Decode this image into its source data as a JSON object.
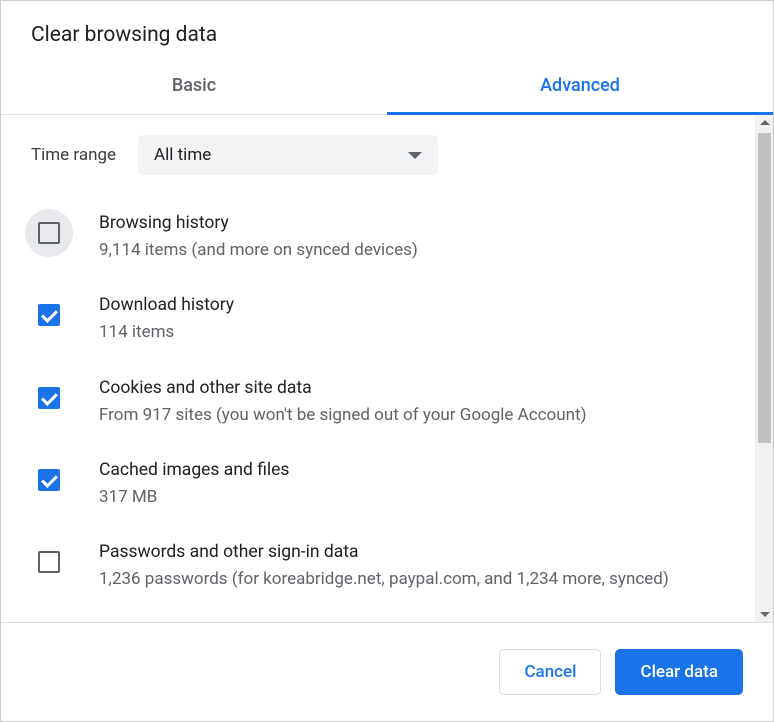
{
  "dialog": {
    "title": "Clear browsing data",
    "tabs": {
      "basic": "Basic",
      "advanced": "Advanced"
    },
    "time_range_label": "Time range",
    "time_range_value": "All time",
    "items": [
      {
        "title": "Browsing history",
        "subtitle": "9,114 items (and more on synced devices)",
        "checked": false,
        "hover": true
      },
      {
        "title": "Download history",
        "subtitle": "114 items",
        "checked": true
      },
      {
        "title": "Cookies and other site data",
        "subtitle": "From 917 sites (you won't be signed out of your Google Account)",
        "checked": true
      },
      {
        "title": "Cached images and files",
        "subtitle": "317 MB",
        "checked": true
      },
      {
        "title": "Passwords and other sign-in data",
        "subtitle": "1,236 passwords (for koreabridge.net, paypal.com, and 1,234 more, synced)",
        "checked": false
      }
    ],
    "buttons": {
      "cancel": "Cancel",
      "confirm": "Clear data"
    }
  }
}
